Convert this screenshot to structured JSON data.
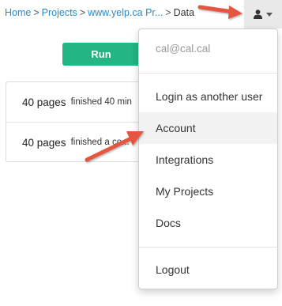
{
  "breadcrumb": {
    "items": [
      "Home",
      "Projects",
      "www.yelp.ca Pr...",
      "Data"
    ],
    "separator": ">"
  },
  "user_menu": {
    "icon": "user-icon",
    "email": "cal@cal.cal",
    "items": {
      "login_as": "Login as another user",
      "account": "Account",
      "integrations": "Integrations",
      "my_projects": "My Projects",
      "docs": "Docs",
      "logout": "Logout"
    }
  },
  "actions": {
    "run_label": "Run"
  },
  "runs": [
    {
      "pages": "40 pages",
      "status": "finished 40 min"
    },
    {
      "pages": "40 pages",
      "status": "finished a co..."
    }
  ],
  "colors": {
    "link": "#2a8ac8",
    "run_button": "#23b583",
    "annotation_arrow": "#e4563f"
  }
}
